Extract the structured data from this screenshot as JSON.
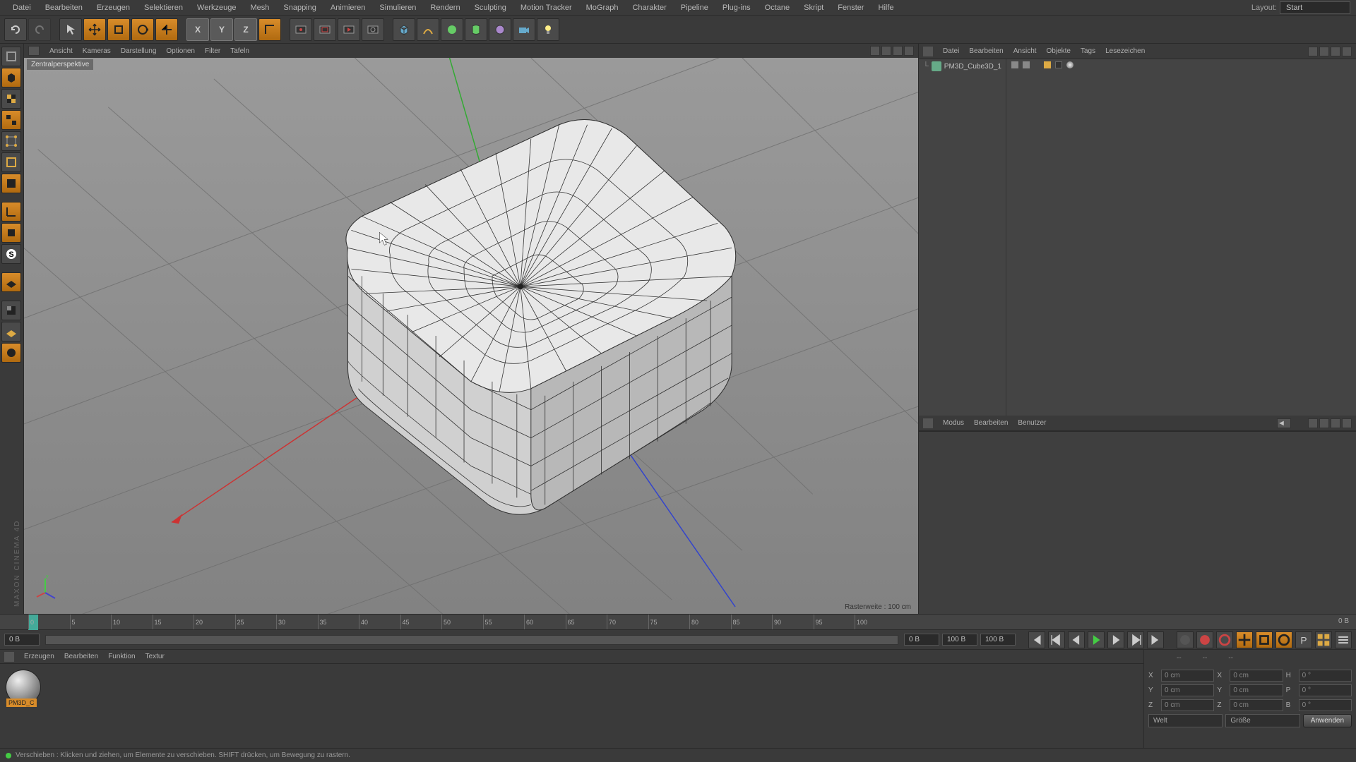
{
  "menubar": [
    "Datei",
    "Bearbeiten",
    "Erzeugen",
    "Selektieren",
    "Werkzeuge",
    "Mesh",
    "Snapping",
    "Animieren",
    "Simulieren",
    "Rendern",
    "Sculpting",
    "Motion Tracker",
    "MoGraph",
    "Charakter",
    "Pipeline",
    "Plug-ins",
    "Octane",
    "Skript",
    "Fenster",
    "Hilfe"
  ],
  "layout": {
    "label": "Layout:",
    "value": "Start"
  },
  "viewport": {
    "menu": [
      "Ansicht",
      "Kameras",
      "Darstellung",
      "Optionen",
      "Filter",
      "Tafeln"
    ],
    "projection": "Zentralperspektive",
    "raster": "Rasterweite : 100 cm"
  },
  "objects_panel": {
    "menu": [
      "Datei",
      "Bearbeiten",
      "Ansicht",
      "Objekte",
      "Tags",
      "Lesezeichen"
    ],
    "object_name": "PM3D_Cube3D_1"
  },
  "attribute_panel": {
    "menu": [
      "Modus",
      "Bearbeiten",
      "Benutzer"
    ]
  },
  "timeline": {
    "ticks": [
      "0",
      "5",
      "10",
      "15",
      "20",
      "25",
      "30",
      "35",
      "40",
      "45",
      "50",
      "55",
      "60",
      "65",
      "70",
      "75",
      "80",
      "85",
      "90",
      "95",
      "100"
    ],
    "frame_start": "0 B",
    "frame_end": "100 B",
    "range_start": "0 B",
    "range_end": "100 B",
    "more": "0 B"
  },
  "material": {
    "menu": [
      "Erzeugen",
      "Bearbeiten",
      "Funktion",
      "Textur"
    ],
    "thumb_label": "PM3D_C"
  },
  "coords": {
    "headers": [
      "--",
      "--",
      "--"
    ],
    "rows": [
      {
        "axis": "X",
        "pos": "0 cm",
        "size": "0 cm",
        "rot_lbl": "H",
        "rot": "0 °",
        "size_lbl": "X"
      },
      {
        "axis": "Y",
        "pos": "0 cm",
        "size": "0 cm",
        "rot_lbl": "P",
        "rot": "0 °",
        "size_lbl": "Y"
      },
      {
        "axis": "Z",
        "pos": "0 cm",
        "size": "0 cm",
        "rot_lbl": "B",
        "rot": "0 °",
        "size_lbl": "Z"
      }
    ],
    "dd1": "Welt",
    "dd2": "Größe",
    "apply": "Anwenden"
  },
  "status": "Verschieben : Klicken und ziehen, um Elemente zu verschieben. SHIFT drücken, um Bewegung zu rastern.",
  "watermark": "MAXON CINEMA 4D"
}
